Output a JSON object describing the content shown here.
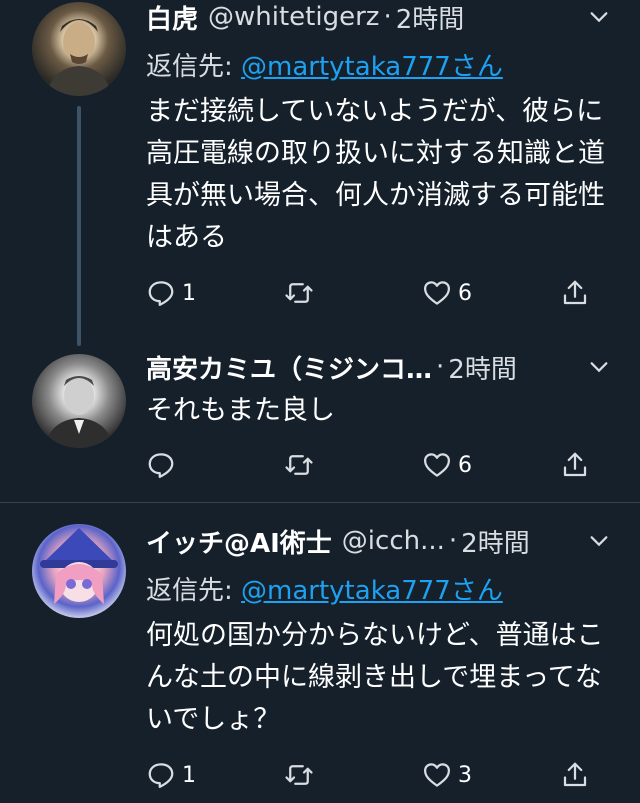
{
  "tweets": [
    {
      "name": "白虎",
      "handle": "@whitetigerz",
      "dot": "·",
      "time": "2時間",
      "reply_prefix": "返信先: ",
      "reply_mention": "@martytaka777さん",
      "text": "まだ接続していないようだが、彼らに高圧電線の取り扱いに対する知識と道具が無い場合、何人か消滅する可能性はある",
      "reply_count": "1",
      "like_count": "6"
    },
    {
      "name": "高安カミユ（ミジンコ…",
      "handle": "",
      "dot": "·",
      "time": "2時間",
      "text": "それもまた良し",
      "reply_count": "",
      "like_count": "6"
    },
    {
      "name": "イッチ@AI術士",
      "handle": "@icch...",
      "dot": "·",
      "time": "2時間",
      "reply_prefix": "返信先: ",
      "reply_mention": "@martytaka777さん",
      "text": "何処の国か分からないけど、普通はこんな土の中に線剥き出しで埋まってないでしょ？",
      "reply_count": "1",
      "like_count": "3"
    }
  ],
  "colors": {
    "background": "#15202b",
    "mention": "#1da1f2",
    "secondary_text": "#d9dde2",
    "divider": "#38444d"
  },
  "icons": [
    "reply-icon",
    "retweet-icon",
    "like-icon",
    "share-icon",
    "chevron-down-icon"
  ]
}
